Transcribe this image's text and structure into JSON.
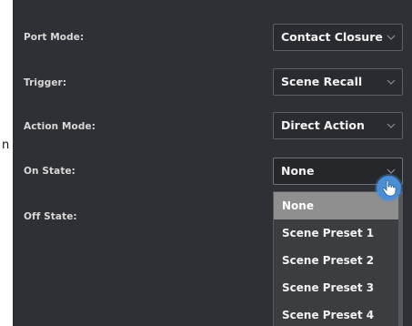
{
  "edge_fragment": "n",
  "rows": [
    {
      "label": "Port Mode:",
      "value": "Contact Closure"
    },
    {
      "label": "Trigger:",
      "value": "Scene Recall"
    },
    {
      "label": "Action Mode:",
      "value": "Direct Action"
    },
    {
      "label": "On State:",
      "value": "None"
    },
    {
      "label": "Off State:",
      "value": ""
    }
  ],
  "dropdown": {
    "options": [
      "None",
      "Scene Preset 1",
      "Scene Preset 2",
      "Scene Preset 3",
      "Scene Preset 4"
    ],
    "selected": "None"
  },
  "icons": {
    "chevron": "chevron-down-icon",
    "cursor": "hand-pointer-icon"
  },
  "colors": {
    "panel": "#2f3035",
    "field": "#2a2b30",
    "highlight": "#8f8f8f",
    "cursor_ring": "#4a8fd6"
  }
}
